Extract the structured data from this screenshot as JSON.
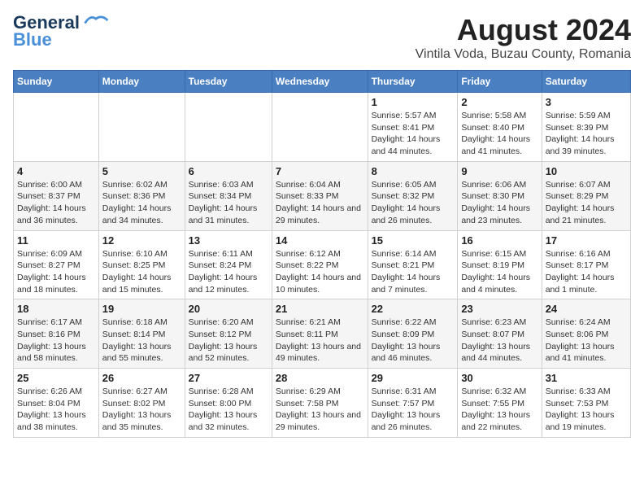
{
  "logo": {
    "line1": "General",
    "line2": "Blue"
  },
  "title": "August 2024",
  "subtitle": "Vintila Voda, Buzau County, Romania",
  "days_of_week": [
    "Sunday",
    "Monday",
    "Tuesday",
    "Wednesday",
    "Thursday",
    "Friday",
    "Saturday"
  ],
  "weeks": [
    [
      {
        "num": "",
        "info": ""
      },
      {
        "num": "",
        "info": ""
      },
      {
        "num": "",
        "info": ""
      },
      {
        "num": "",
        "info": ""
      },
      {
        "num": "1",
        "info": "Sunrise: 5:57 AM\nSunset: 8:41 PM\nDaylight: 14 hours and 44 minutes."
      },
      {
        "num": "2",
        "info": "Sunrise: 5:58 AM\nSunset: 8:40 PM\nDaylight: 14 hours and 41 minutes."
      },
      {
        "num": "3",
        "info": "Sunrise: 5:59 AM\nSunset: 8:39 PM\nDaylight: 14 hours and 39 minutes."
      }
    ],
    [
      {
        "num": "4",
        "info": "Sunrise: 6:00 AM\nSunset: 8:37 PM\nDaylight: 14 hours and 36 minutes."
      },
      {
        "num": "5",
        "info": "Sunrise: 6:02 AM\nSunset: 8:36 PM\nDaylight: 14 hours and 34 minutes."
      },
      {
        "num": "6",
        "info": "Sunrise: 6:03 AM\nSunset: 8:34 PM\nDaylight: 14 hours and 31 minutes."
      },
      {
        "num": "7",
        "info": "Sunrise: 6:04 AM\nSunset: 8:33 PM\nDaylight: 14 hours and 29 minutes."
      },
      {
        "num": "8",
        "info": "Sunrise: 6:05 AM\nSunset: 8:32 PM\nDaylight: 14 hours and 26 minutes."
      },
      {
        "num": "9",
        "info": "Sunrise: 6:06 AM\nSunset: 8:30 PM\nDaylight: 14 hours and 23 minutes."
      },
      {
        "num": "10",
        "info": "Sunrise: 6:07 AM\nSunset: 8:29 PM\nDaylight: 14 hours and 21 minutes."
      }
    ],
    [
      {
        "num": "11",
        "info": "Sunrise: 6:09 AM\nSunset: 8:27 PM\nDaylight: 14 hours and 18 minutes."
      },
      {
        "num": "12",
        "info": "Sunrise: 6:10 AM\nSunset: 8:25 PM\nDaylight: 14 hours and 15 minutes."
      },
      {
        "num": "13",
        "info": "Sunrise: 6:11 AM\nSunset: 8:24 PM\nDaylight: 14 hours and 12 minutes."
      },
      {
        "num": "14",
        "info": "Sunrise: 6:12 AM\nSunset: 8:22 PM\nDaylight: 14 hours and 10 minutes."
      },
      {
        "num": "15",
        "info": "Sunrise: 6:14 AM\nSunset: 8:21 PM\nDaylight: 14 hours and 7 minutes."
      },
      {
        "num": "16",
        "info": "Sunrise: 6:15 AM\nSunset: 8:19 PM\nDaylight: 14 hours and 4 minutes."
      },
      {
        "num": "17",
        "info": "Sunrise: 6:16 AM\nSunset: 8:17 PM\nDaylight: 14 hours and 1 minute."
      }
    ],
    [
      {
        "num": "18",
        "info": "Sunrise: 6:17 AM\nSunset: 8:16 PM\nDaylight: 13 hours and 58 minutes."
      },
      {
        "num": "19",
        "info": "Sunrise: 6:18 AM\nSunset: 8:14 PM\nDaylight: 13 hours and 55 minutes."
      },
      {
        "num": "20",
        "info": "Sunrise: 6:20 AM\nSunset: 8:12 PM\nDaylight: 13 hours and 52 minutes."
      },
      {
        "num": "21",
        "info": "Sunrise: 6:21 AM\nSunset: 8:11 PM\nDaylight: 13 hours and 49 minutes."
      },
      {
        "num": "22",
        "info": "Sunrise: 6:22 AM\nSunset: 8:09 PM\nDaylight: 13 hours and 46 minutes."
      },
      {
        "num": "23",
        "info": "Sunrise: 6:23 AM\nSunset: 8:07 PM\nDaylight: 13 hours and 44 minutes."
      },
      {
        "num": "24",
        "info": "Sunrise: 6:24 AM\nSunset: 8:06 PM\nDaylight: 13 hours and 41 minutes."
      }
    ],
    [
      {
        "num": "25",
        "info": "Sunrise: 6:26 AM\nSunset: 8:04 PM\nDaylight: 13 hours and 38 minutes."
      },
      {
        "num": "26",
        "info": "Sunrise: 6:27 AM\nSunset: 8:02 PM\nDaylight: 13 hours and 35 minutes."
      },
      {
        "num": "27",
        "info": "Sunrise: 6:28 AM\nSunset: 8:00 PM\nDaylight: 13 hours and 32 minutes."
      },
      {
        "num": "28",
        "info": "Sunrise: 6:29 AM\nSunset: 7:58 PM\nDaylight: 13 hours and 29 minutes."
      },
      {
        "num": "29",
        "info": "Sunrise: 6:31 AM\nSunset: 7:57 PM\nDaylight: 13 hours and 26 minutes."
      },
      {
        "num": "30",
        "info": "Sunrise: 6:32 AM\nSunset: 7:55 PM\nDaylight: 13 hours and 22 minutes."
      },
      {
        "num": "31",
        "info": "Sunrise: 6:33 AM\nSunset: 7:53 PM\nDaylight: 13 hours and 19 minutes."
      }
    ]
  ]
}
